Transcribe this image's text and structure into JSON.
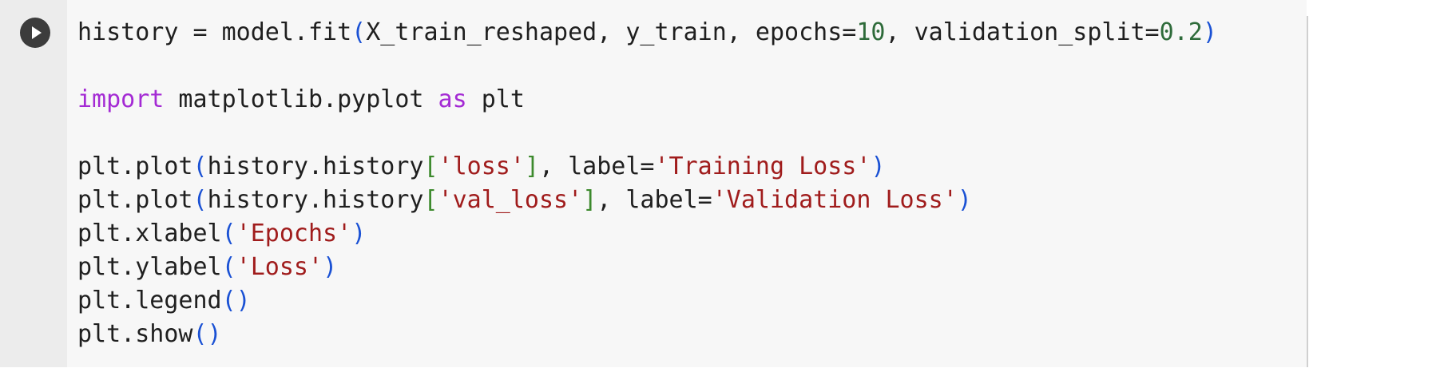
{
  "cell": {
    "run_button_icon": "play-circle-icon",
    "lines": [
      [
        {
          "t": "history = model.fit",
          "c": "plain"
        },
        {
          "t": "(",
          "c": "paren"
        },
        {
          "t": "X_train_reshaped, y_train, epochs=",
          "c": "plain"
        },
        {
          "t": "10",
          "c": "num"
        },
        {
          "t": ", validation_split=",
          "c": "plain"
        },
        {
          "t": "0.2",
          "c": "num"
        },
        {
          "t": ")",
          "c": "paren"
        }
      ],
      [],
      [
        {
          "t": "import",
          "c": "kw"
        },
        {
          "t": " matplotlib.pyplot ",
          "c": "plain"
        },
        {
          "t": "as",
          "c": "kw"
        },
        {
          "t": " plt",
          "c": "plain"
        }
      ],
      [],
      [
        {
          "t": "plt.plot",
          "c": "plain"
        },
        {
          "t": "(",
          "c": "paren"
        },
        {
          "t": "history.history",
          "c": "plain"
        },
        {
          "t": "[",
          "c": "bracket"
        },
        {
          "t": "'loss'",
          "c": "str"
        },
        {
          "t": "]",
          "c": "bracket"
        },
        {
          "t": ", label=",
          "c": "plain"
        },
        {
          "t": "'Training Loss'",
          "c": "str"
        },
        {
          "t": ")",
          "c": "paren"
        }
      ],
      [
        {
          "t": "plt.plot",
          "c": "plain"
        },
        {
          "t": "(",
          "c": "paren"
        },
        {
          "t": "history.history",
          "c": "plain"
        },
        {
          "t": "[",
          "c": "bracket"
        },
        {
          "t": "'val_loss'",
          "c": "str"
        },
        {
          "t": "]",
          "c": "bracket"
        },
        {
          "t": ", label=",
          "c": "plain"
        },
        {
          "t": "'Validation Loss'",
          "c": "str"
        },
        {
          "t": ")",
          "c": "paren"
        }
      ],
      [
        {
          "t": "plt.xlabel",
          "c": "plain"
        },
        {
          "t": "(",
          "c": "paren"
        },
        {
          "t": "'Epochs'",
          "c": "str"
        },
        {
          "t": ")",
          "c": "paren"
        }
      ],
      [
        {
          "t": "plt.ylabel",
          "c": "plain"
        },
        {
          "t": "(",
          "c": "paren"
        },
        {
          "t": "'Loss'",
          "c": "str"
        },
        {
          "t": ")",
          "c": "paren"
        }
      ],
      [
        {
          "t": "plt.legend",
          "c": "plain"
        },
        {
          "t": "()",
          "c": "paren"
        }
      ],
      [
        {
          "t": "plt.show",
          "c": "plain"
        },
        {
          "t": "()",
          "c": "paren"
        }
      ]
    ]
  },
  "colors": {
    "keyword": "#a42ad4",
    "string": "#a01c1c",
    "number": "#2e6b3a",
    "paren": "#1a51d4",
    "bracket": "#3d8a2d",
    "text": "#1f1f1f",
    "editor_background": "#f7f7f7",
    "gutter_background": "#ececec"
  }
}
